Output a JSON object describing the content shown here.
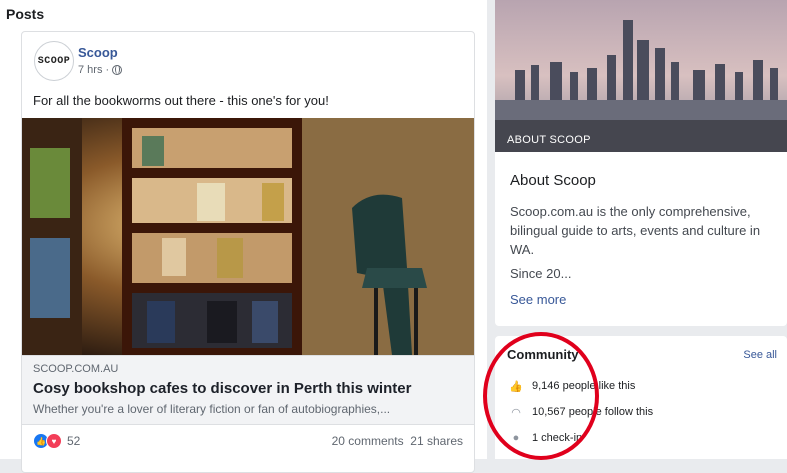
{
  "feed": {
    "heading": "Posts"
  },
  "post": {
    "avatar_text": "SCOOP",
    "author": "Scoop",
    "time": "7 hrs ·",
    "text": "For all the bookworms out there - this one's for you!",
    "link": {
      "domain": "SCOOP.COM.AU",
      "title": "Cosy bookshop cafes to discover in Perth this winter",
      "description": "Whether you're a lover of literary fiction or fan of autobiographies,..."
    },
    "reactions_count": "52",
    "engagement": "20 comments  21 shares",
    "icons": {
      "privacy": "globe-icon",
      "like": "like-reaction-icon",
      "love": "love-reaction-icon"
    }
  },
  "about": {
    "cover_label": "ABOUT SCOOP",
    "title": "About Scoop",
    "description": "Scoop.com.au is the only comprehensive, bilingual guide to arts, events and culture in WA.",
    "since": "Since 20...",
    "see_more": "See more"
  },
  "community": {
    "title": "Community",
    "see_all": "See all",
    "likes": "9,146 people like this",
    "follows": "10,567 people follow this",
    "checkins": "1 check-in",
    "icons": {
      "likes": "thumbs-up-icon",
      "follows": "rss-icon",
      "checkins": "map-pin-icon"
    }
  },
  "colors": {
    "link": "#385898",
    "highlight": "#e0001c",
    "background": "#e9ebee"
  }
}
